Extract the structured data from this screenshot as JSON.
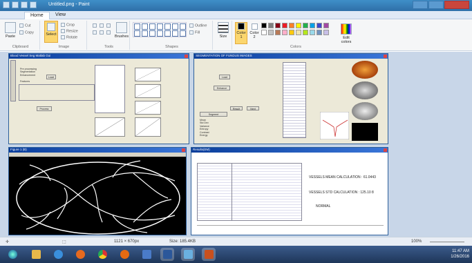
{
  "window": {
    "title": "Untitled.png - Paint"
  },
  "tabs": [
    "Home",
    "View"
  ],
  "ribbon": {
    "clipboard": {
      "label": "Clipboard",
      "paste": "Paste",
      "cut": "Cut",
      "copy": "Copy"
    },
    "image": {
      "label": "Image",
      "select": "Select",
      "crop": "Crop",
      "resize": "Resize",
      "rotate": "Rotate"
    },
    "tools": {
      "label": "Tools",
      "brushes": "Brushes"
    },
    "shapes": {
      "label": "Shapes",
      "outline": "Outline",
      "fill": "Fill"
    },
    "size": "Size",
    "colors": {
      "label": "Colors",
      "color1": "Color 1",
      "color2": "Color 2",
      "edit": "Edit colors",
      "palette": [
        "#000000",
        "#7f7f7f",
        "#880015",
        "#ed1c24",
        "#ff7f27",
        "#fff200",
        "#22b14c",
        "#00a2e8",
        "#3f48cc",
        "#a349a4",
        "#ffffff",
        "#c3c3c3",
        "#b97a57",
        "#ffaec9",
        "#ffc90e",
        "#efe4b0",
        "#b5e61d",
        "#99d9ea",
        "#7092be",
        "#c8bfe7"
      ]
    }
  },
  "canvas": {
    "win1": {
      "title": "Blood Vessel Seg Matlab Gui",
      "lines": "Pre processing\nSegmentation\nEnhancement\n\nFeatures",
      "btn1": "Load",
      "btn2": "Process"
    },
    "win2": {
      "title": "SEGMENTATION OF FUNDUS IMAGES",
      "btn1": "Load",
      "btn2": "Enhance",
      "btn3": "Segment",
      "btn4": "Result",
      "btn5": "Next",
      "lines": "Mean\nStd Dev\nVariance\nEntropy\nContrast\nEnergy"
    },
    "win3": {
      "title": "Figure 1 (B)"
    },
    "win4": {
      "title": "Results(EM)",
      "r1": "VESSELS MEAN CALCULATION : 61.0443",
      "r2": "VESSELS STD CALCULATION : 125.10 8",
      "r3": "NORMAL"
    }
  },
  "status": {
    "dimensions": "1121 × 670px",
    "size": "Size: 185.4KB",
    "zoom": "100%"
  },
  "taskbar": {
    "time": "11:47 AM",
    "date": "1/26/2016"
  }
}
